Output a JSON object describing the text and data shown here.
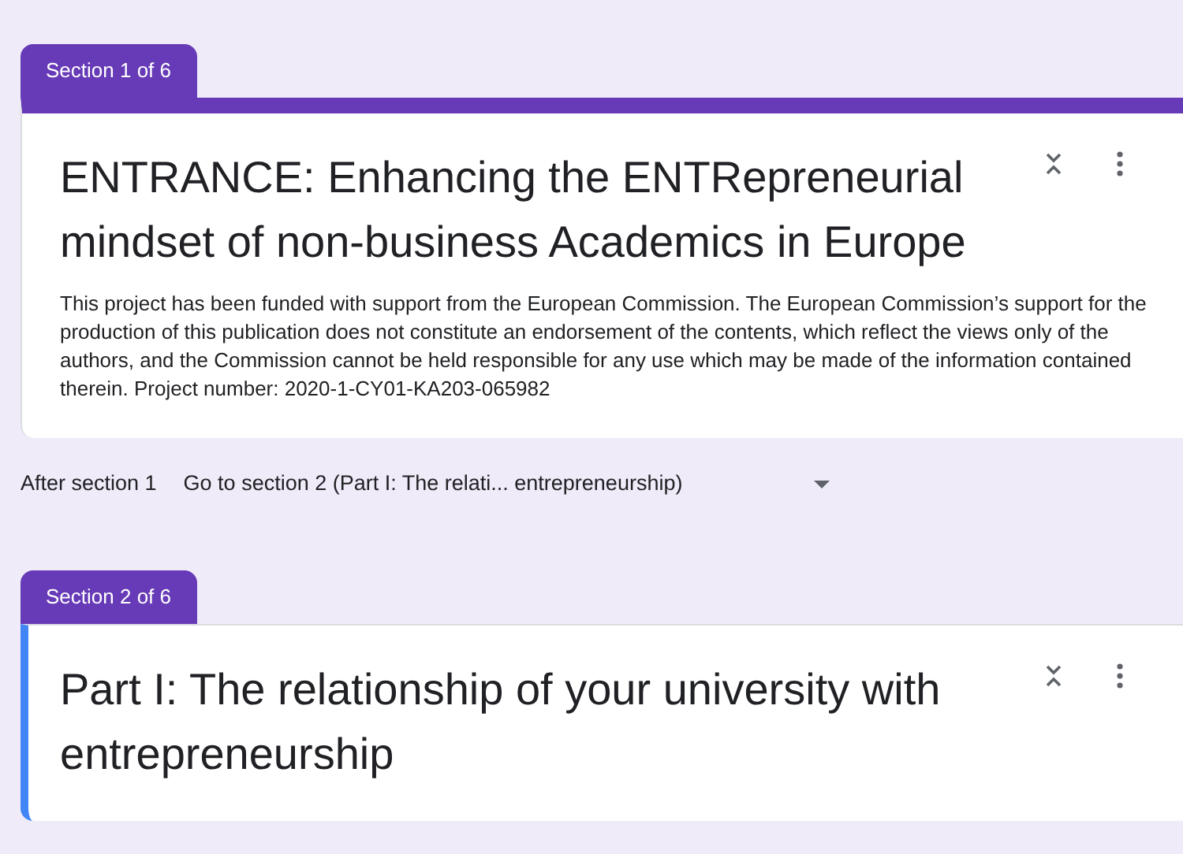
{
  "sections": [
    {
      "tab": "Section 1 of 6",
      "selected": false,
      "title": "ENTRANCE: Enhancing the ENTRepreneurial mindset of non-business Academics in Europe",
      "description": "This project has been funded with support from the European Commission. The European Commission’s support for the production of this publication does not constitute an endorsement of the contents, which reflect the views only of the authors, and the Commission cannot be held responsible for any use which may be made of the information contained therein. Project number: 2020-1-CY01-KA203-065982",
      "after": {
        "label": "After section 1",
        "value": "Go to section 2 (Part I: The relati... entrepreneurship)"
      }
    },
    {
      "tab": "Section 2 of 6",
      "selected": true,
      "title": "Part I: The relationship of your university with entrepreneurship"
    }
  ]
}
